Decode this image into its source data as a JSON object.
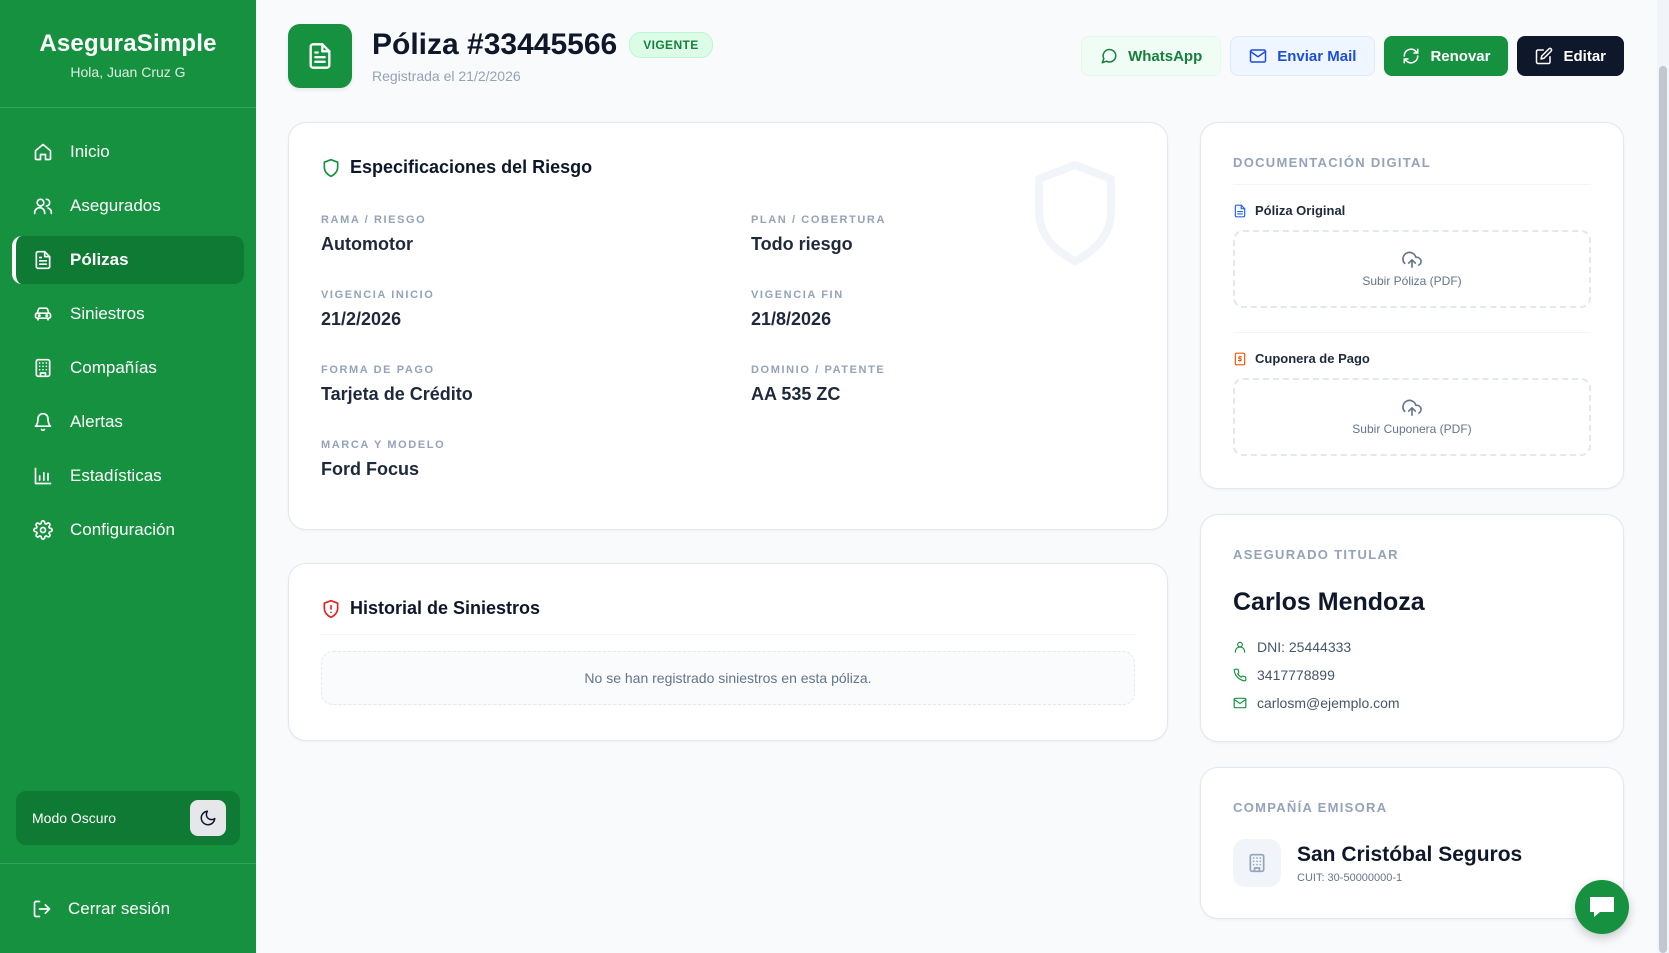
{
  "sidebar": {
    "brand": "AseguraSimple",
    "greeting": "Hola, Juan Cruz G",
    "items": [
      {
        "label": "Inicio",
        "icon": "home-icon"
      },
      {
        "label": "Asegurados",
        "icon": "users-icon"
      },
      {
        "label": "Pólizas",
        "icon": "file-text-icon",
        "active": true
      },
      {
        "label": "Siniestros",
        "icon": "car-icon"
      },
      {
        "label": "Compañías",
        "icon": "building-icon"
      },
      {
        "label": "Alertas",
        "icon": "bell-icon"
      },
      {
        "label": "Estadísticas",
        "icon": "bar-chart-icon"
      },
      {
        "label": "Configuración",
        "icon": "gear-icon"
      }
    ],
    "dark_mode_label": "Modo Oscuro",
    "logout_label": "Cerrar sesión"
  },
  "header": {
    "title": "Póliza #33445566",
    "status": "VIGENTE",
    "subtitle": "Registrada el 21/2/2026",
    "actions": {
      "whatsapp": "WhatsApp",
      "mail": "Enviar Mail",
      "renew": "Renovar",
      "edit": "Editar"
    }
  },
  "specs": {
    "title": "Especificaciones del Riesgo",
    "fields": [
      {
        "label": "RAMA / RIESGO",
        "value": "Automotor"
      },
      {
        "label": "PLAN / COBERTURA",
        "value": "Todo riesgo"
      },
      {
        "label": "VIGENCIA INICIO",
        "value": "21/2/2026"
      },
      {
        "label": "VIGENCIA FIN",
        "value": "21/8/2026"
      },
      {
        "label": "FORMA DE PAGO",
        "value": "Tarjeta de Crédito"
      },
      {
        "label": "DOMINIO / PATENTE",
        "value": "AA 535 ZC"
      },
      {
        "label": "MARCA Y MODELO",
        "value": "Ford Focus"
      }
    ]
  },
  "history": {
    "title": "Historial de Siniestros",
    "empty_message": "No se han registrado siniestros en esta póliza."
  },
  "documents": {
    "title": "DOCUMENTACIÓN DIGITAL",
    "policy_label": "Póliza Original",
    "policy_upload": "Subir Póliza (PDF)",
    "coupon_label": "Cuponera de Pago",
    "coupon_upload": "Subir Cuponera (PDF)"
  },
  "owner": {
    "title": "ASEGURADO TITULAR",
    "name": "Carlos Mendoza",
    "dni": "DNI: 25444333",
    "phone": "3417778899",
    "email": "carlosm@ejemplo.com"
  },
  "company": {
    "title": "COMPAÑÍA EMISORA",
    "name": "San Cristóbal Seguros",
    "cuit": "CUIT: 30-50000000-1"
  },
  "colors": {
    "brand_green": "#15913f",
    "dark": "#0f172a",
    "status_bg": "#dcfce7"
  }
}
